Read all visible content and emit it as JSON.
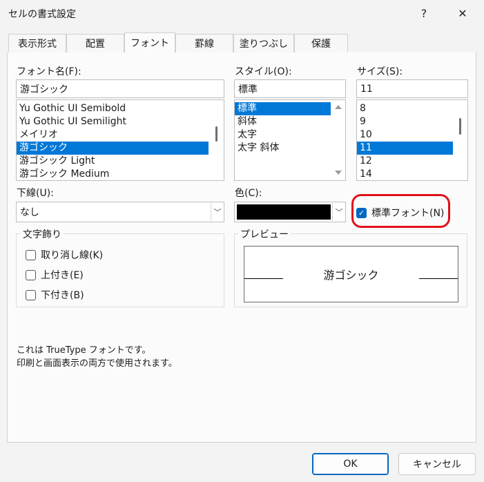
{
  "window": {
    "title": "セルの書式設定",
    "help_label": "?",
    "close_label": "✕"
  },
  "tabs": [
    {
      "label": "表示形式"
    },
    {
      "label": "配置"
    },
    {
      "label": "フォント"
    },
    {
      "label": "罫線"
    },
    {
      "label": "塗りつぶし"
    },
    {
      "label": "保護"
    }
  ],
  "font_name": {
    "label": "フォント名(F):",
    "value": "游ゴシック",
    "items": [
      "Yu Gothic UI Semibold",
      "Yu Gothic UI Semilight",
      "メイリオ",
      "游ゴシック",
      "游ゴシック Light",
      "游ゴシック Medium"
    ],
    "selected": "游ゴシック"
  },
  "style": {
    "label": "スタイル(O):",
    "value": "標準",
    "items": [
      "標準",
      "斜体",
      "太字",
      "太字 斜体"
    ],
    "selected": "標準"
  },
  "size": {
    "label": "サイズ(S):",
    "value": "11",
    "items": [
      "8",
      "9",
      "10",
      "11",
      "12",
      "14"
    ],
    "selected": "11"
  },
  "underline": {
    "label": "下線(U):",
    "value": "なし"
  },
  "color": {
    "label": "色(C):",
    "swatch": "#000000"
  },
  "normal_font": {
    "label": "標準フォント(N)",
    "checked": true,
    "highlight_color": "#e0101a"
  },
  "effects": {
    "label": "文字飾り",
    "strikethrough": "取り消し線(K)",
    "superscript": "上付き(E)",
    "subscript": "下付き(B)"
  },
  "preview": {
    "label": "プレビュー",
    "text": "游ゴシック"
  },
  "info": {
    "line1": "これは TrueType フォントです。",
    "line2": "印刷と画面表示の両方で使用されます。"
  },
  "buttons": {
    "ok": "OK",
    "cancel": "キャンセル"
  },
  "colors": {
    "selection": "#0078d7",
    "accent": "#0067c0"
  }
}
